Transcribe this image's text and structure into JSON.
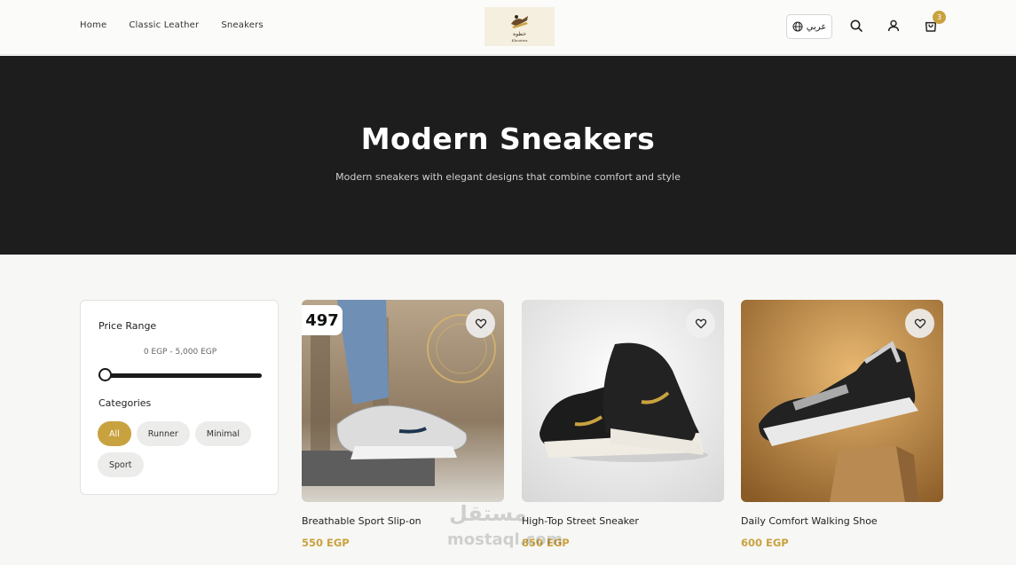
{
  "nav": {
    "items": [
      {
        "label": "Home"
      },
      {
        "label": "Classic Leather"
      },
      {
        "label": "Sneakers"
      }
    ]
  },
  "brand": {
    "logo_arabic": "خطوة",
    "logo_latin": "Khoutwa"
  },
  "header": {
    "lang_label": "عربي",
    "cart_count": "3"
  },
  "hero": {
    "title": "Modern Sneakers",
    "subtitle": "Modern sneakers with elegant designs that combine comfort and style"
  },
  "filters": {
    "price_title": "Price Range",
    "price_range": "0 EGP - 5,000 EGP",
    "categories_title": "Categories",
    "categories": [
      {
        "label": "All",
        "active": true
      },
      {
        "label": "Runner",
        "active": false
      },
      {
        "label": "Minimal",
        "active": false
      },
      {
        "label": "Sport",
        "active": false
      }
    ]
  },
  "products": [
    {
      "name": "Breathable Sport Slip-on",
      "price": "550 EGP",
      "badge": "497"
    },
    {
      "name": "High-Top Street Sneaker",
      "price": "850 EGP"
    },
    {
      "name": "Daily Comfort Walking Shoe",
      "price": "600 EGP"
    }
  ],
  "watermark": {
    "arabic": "مستقل",
    "latin": "mostaql.com"
  },
  "colors": {
    "accent": "#c9a240",
    "hero_bg": "#1d1d1d",
    "page_bg": "#f7f7f5"
  }
}
